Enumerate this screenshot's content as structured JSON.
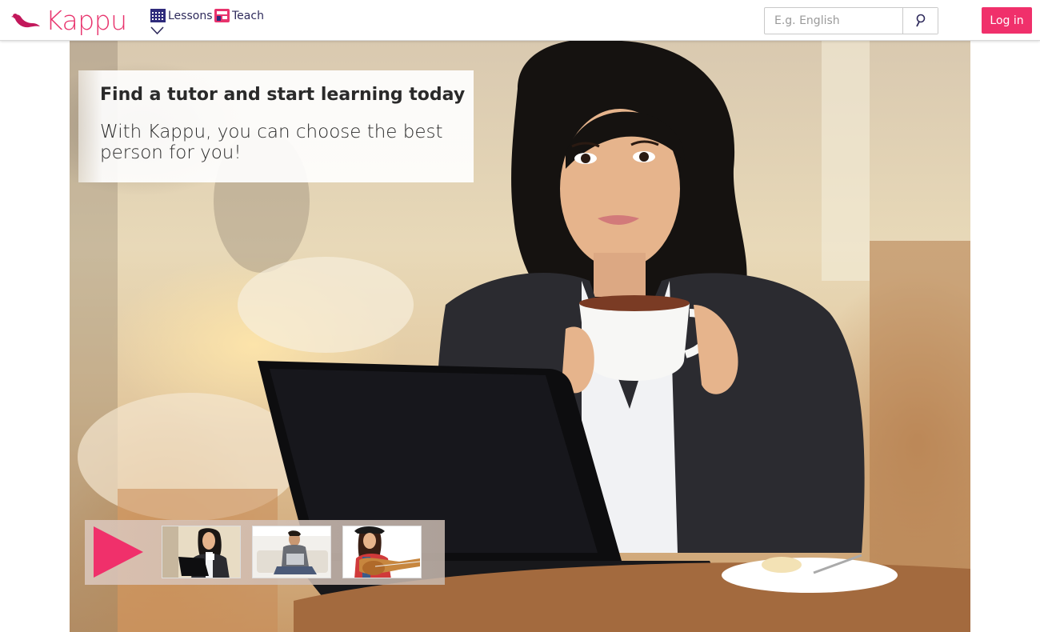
{
  "header": {
    "logo_text": "Kappu",
    "nav": [
      {
        "label": "Lessons",
        "icon": "calendar-grid-icon"
      },
      {
        "label": "Teach",
        "icon": "store-icon"
      }
    ],
    "search": {
      "placeholder": "E.g. English",
      "value": ""
    },
    "login_label": "Log in"
  },
  "hero": {
    "title": "Find a tutor and start learning today",
    "subtitle": "With Kappu, you can choose the best person for you!"
  },
  "video_strip": {
    "thumbnails": [
      {
        "icon": "woman-laptop-thumbnail"
      },
      {
        "icon": "man-laptop-thumbnail"
      },
      {
        "icon": "girl-guitar-thumbnail"
      }
    ]
  },
  "colors": {
    "brand_pink": "#f0306b",
    "logo_pink": "#e8336d",
    "nav_text": "#2f2b5c"
  }
}
